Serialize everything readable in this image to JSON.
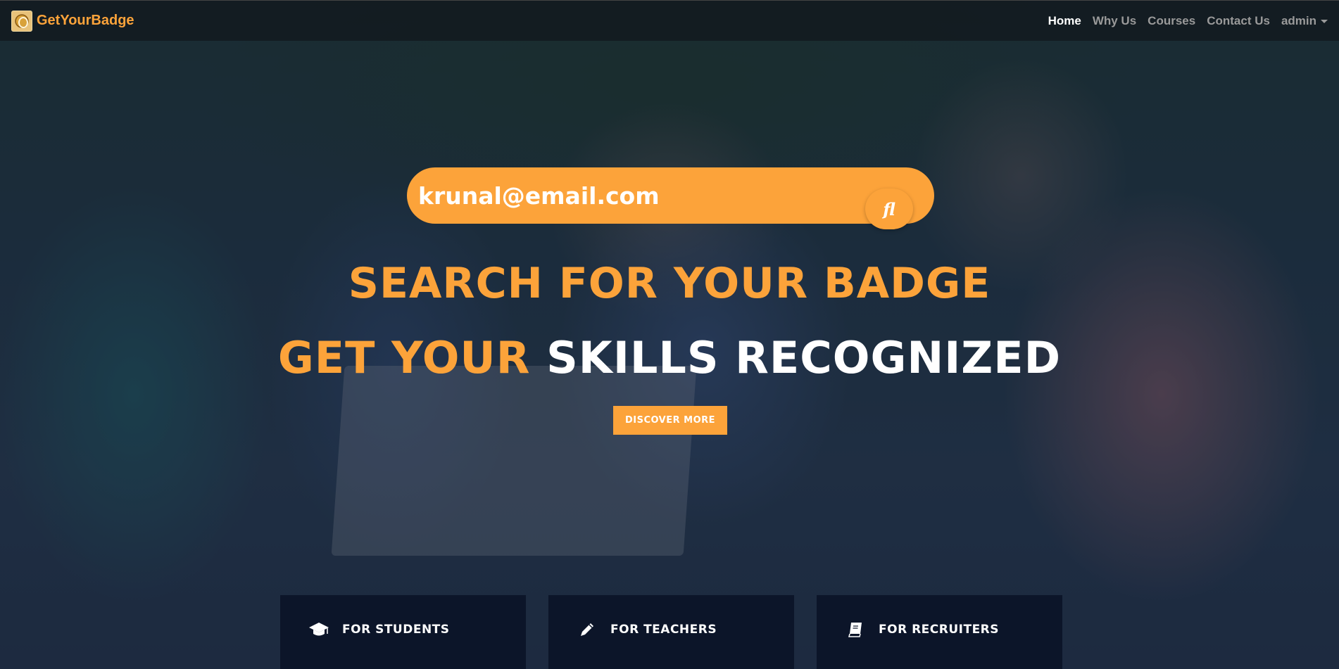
{
  "navbar": {
    "brand": "GetYourBadge",
    "links": [
      {
        "label": "Home",
        "active": true
      },
      {
        "label": "Why Us",
        "active": false
      },
      {
        "label": "Courses",
        "active": false
      },
      {
        "label": "Contact Us",
        "active": false
      }
    ],
    "user_menu": "admin"
  },
  "search": {
    "value": "krunal@email.com",
    "button_glyph": "fl",
    "button_icon": "search-icon"
  },
  "hero": {
    "headline_1": "SEARCH FOR YOUR BADGE",
    "headline_2_orange": "GET YOUR",
    "headline_2_white": "SKILLS RECOGNIZED",
    "cta": "DISCOVER MORE"
  },
  "cards": [
    {
      "title": "FOR STUDENTS",
      "icon": "graduation-cap-icon"
    },
    {
      "title": "FOR TEACHERS",
      "icon": "pencil-icon"
    },
    {
      "title": "FOR RECRUITERS",
      "icon": "book-icon"
    }
  ],
  "colors": {
    "accent": "#fca33a",
    "navbar_bg": "#12181e",
    "card_bg": "#0c1529",
    "text_light": "#ffffff",
    "nav_muted": "#9a9a9a"
  }
}
